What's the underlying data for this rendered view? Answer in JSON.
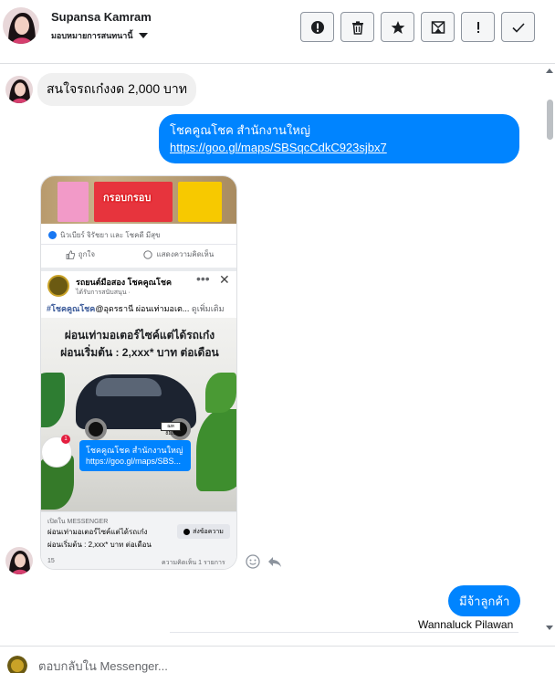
{
  "header": {
    "contact_name": "Supansa Kamram",
    "assign_label": "มอบหมายการสนทนานี้",
    "toolbar": [
      {
        "name": "mark-spam-button",
        "icon": "alert-circle-icon"
      },
      {
        "name": "delete-button",
        "icon": "trash-icon"
      },
      {
        "name": "star-button",
        "icon": "star-icon"
      },
      {
        "name": "archive-button",
        "icon": "archive-icon"
      },
      {
        "name": "follow-up-button",
        "icon": "exclamation-icon"
      },
      {
        "name": "mark-done-button",
        "icon": "checkmark-icon"
      }
    ]
  },
  "messages": {
    "incoming_1": "สนใจรถเก๋งงด 2,000 บาท",
    "outgoing_1_title": "โชคคูณโชค สำนักงานใหญ่",
    "outgoing_1_link": "https://goo.gl/maps/SBSqcCdkC923sjbx7",
    "outgoing_2": "มีจ้าลูกค้า",
    "outgoing_2_sender": "Wannaluck Pilawan"
  },
  "shared_post": {
    "food_label": "กรอบกรอบ",
    "reactions": "นิวเบียร์ จิรัชยา และ โชคดี มีสุข",
    "like_label": "ถูกใจ",
    "comment_label": "แสดงความคิดเห็น",
    "page_name": "รถยนต์มือสอง โชคคูณโชค",
    "sponsored": "ได้รับการสนับสนุน ·",
    "hashtag": "#โชคคูณโชค",
    "post_text": "@อุดรธานี ผ่อนเท่ามอเต...",
    "see_more": "ดูเพิ่มเติม",
    "headline_1": "ผ่อนเท่ามอเตอร์ไซค์แต่ได้รถเก๋ง",
    "headline_2": "ผ่อนเริ่มต้น : 2,xxx* บาท ต่อเดือน",
    "plate_text": "ฌท 8101",
    "notif_count": "1",
    "mini_title": "โชคคูณโชค สำนักงานใหญ่",
    "mini_link": "https://goo.gl/maps/SBS...",
    "open_in": "เปิดใน MESSENGER",
    "sub_1": "ผ่อนเท่ามอเตอร์ไซค์แต่ได้รถเก๋ง",
    "sub_2": "ผ่อนเริ่มต้น : 2,xxx* บาท ต่อเดือน",
    "send_label": "ส่งข้อความ",
    "like_count": "15",
    "comment_count": "ความคิดเห็น 1 รายการ"
  },
  "composer": {
    "placeholder": "ตอบกลับใน Messenger..."
  }
}
